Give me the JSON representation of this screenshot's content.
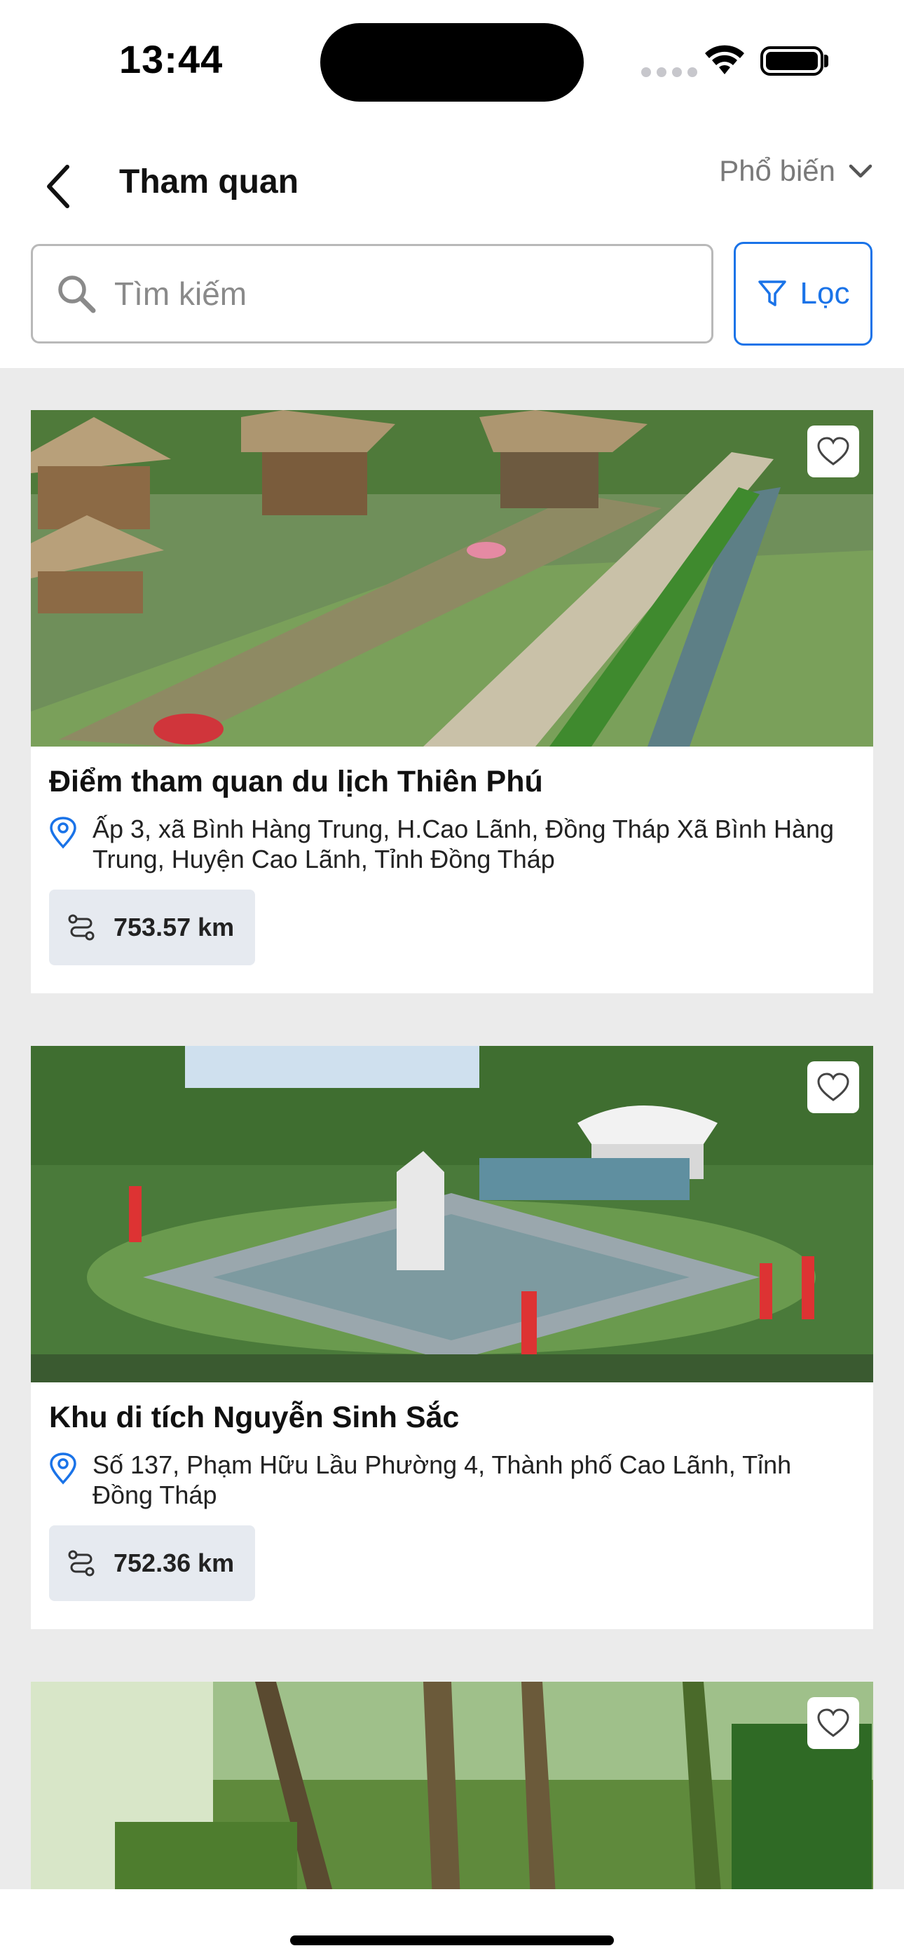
{
  "status_bar": {
    "time": "13:44"
  },
  "header": {
    "title": "Tham quan",
    "sort_label": "Phổ biến",
    "search_placeholder": "Tìm kiếm",
    "filter_label": "Lọc"
  },
  "places": [
    {
      "title": "Điểm tham quan du lịch Thiên Phú",
      "address": "Ấp 3, xã Bình Hàng Trung, H.Cao Lãnh, Đồng Tháp  Xã Bình Hàng Trung, Huyện Cao Lãnh, Tỉnh Đồng Tháp",
      "distance": "753.57 km"
    },
    {
      "title": "Khu di tích Nguyễn Sinh Sắc",
      "address": "Số 137, Phạm Hữu Lầu  Phường 4, Thành phố Cao Lãnh, Tỉnh Đồng Tháp",
      "distance": "752.36 km"
    },
    {
      "title": "",
      "address": "",
      "distance": ""
    }
  ],
  "colors": {
    "accent": "#1a73e8",
    "list_background": "#ebebeb",
    "distance_chip": "#e6eaf0"
  },
  "icons": [
    "back-icon",
    "chevron-down-icon",
    "search-icon",
    "filter-icon",
    "heart-icon",
    "location-pin-icon",
    "route-icon"
  ]
}
